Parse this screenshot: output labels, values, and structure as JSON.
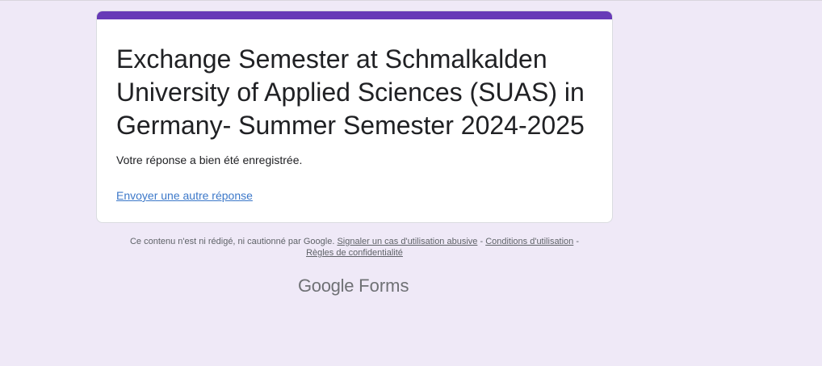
{
  "form": {
    "title": "Exchange Semester at Schmalkalden University of Applied Sciences (SUAS) in Germany- Summer Semester 2024-2025",
    "confirmation": "Votre réponse a bien été enregistrée.",
    "another_response_link": "Envoyer une autre réponse"
  },
  "footer": {
    "disclaimer": "Ce contenu n'est ni rédigé, ni cautionné par Google.",
    "report_abuse": "Signaler un cas d'utilisation abusive",
    "separator1": " - ",
    "terms": "Conditions d'utilisation",
    "separator2": " - ",
    "privacy": "Règles de confidentialité"
  },
  "brand": {
    "google": "Google",
    "forms": "Forms"
  },
  "colors": {
    "background": "#efe9f7",
    "accent": "#673ab7",
    "link": "#3c78c9"
  }
}
